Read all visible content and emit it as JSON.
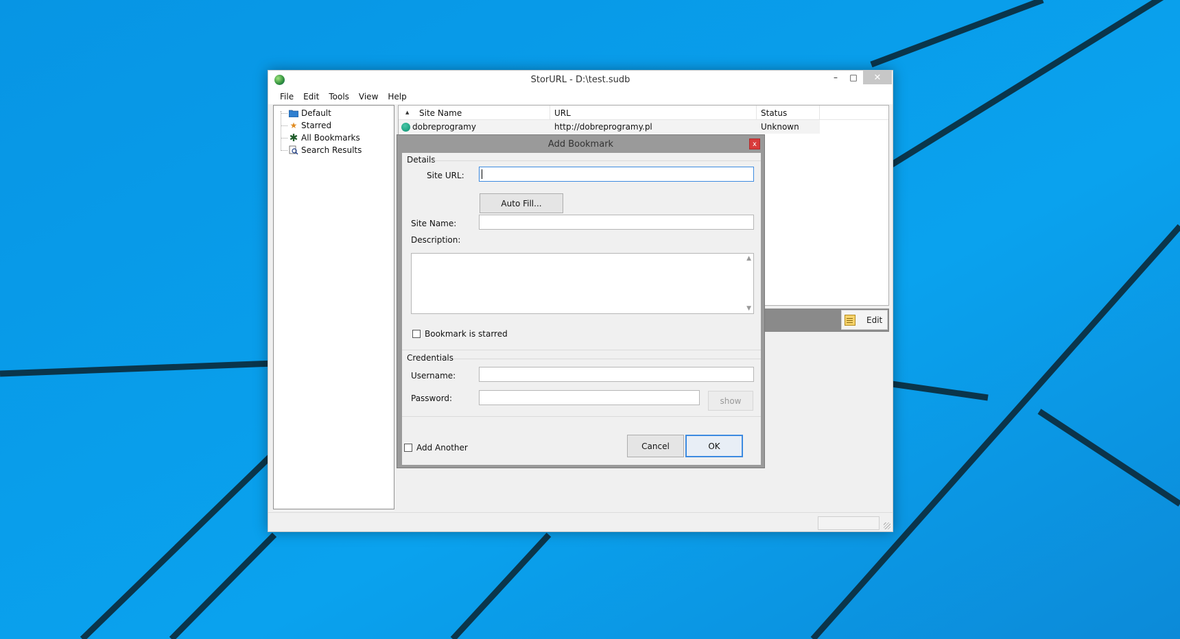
{
  "window": {
    "title": "StorURL - D:\\test.sudb",
    "controls": {
      "minimize": "–",
      "maximize": "□",
      "close": "✕"
    }
  },
  "menu": [
    "File",
    "Edit",
    "Tools",
    "View",
    "Help"
  ],
  "tree": [
    {
      "label": "Default",
      "icon": "folder-icon"
    },
    {
      "label": "Starred",
      "icon": "star-icon"
    },
    {
      "label": "All Bookmarks",
      "icon": "asterisk-icon"
    },
    {
      "label": "Search Results",
      "icon": "search-results-icon"
    }
  ],
  "list": {
    "sort_arrow": "▲",
    "columns": [
      "Site Name",
      "URL",
      "Status"
    ],
    "rows": [
      {
        "site_name": "dobreprogramy",
        "url": "http://dobreprogramy.pl",
        "status": "Unknown"
      }
    ]
  },
  "detail": {
    "edit_label": "Edit"
  },
  "dialog": {
    "title": "Add Bookmark",
    "close": "x",
    "details_group": "Details",
    "site_url_label": "Site URL:",
    "site_url_value": "",
    "autofill_label": "Auto Fill...",
    "site_name_label": "Site Name:",
    "site_name_value": "",
    "description_label": "Description:",
    "description_value": "",
    "starred_label": "Bookmark is starred",
    "starred_checked": false,
    "credentials_group": "Credentials",
    "username_label": "Username:",
    "username_value": "",
    "password_label": "Password:",
    "password_value": "",
    "show_label": "show",
    "add_another_label": "Add Another",
    "add_another_checked": false,
    "cancel_label": "Cancel",
    "ok_label": "OK",
    "scroll_up": "▲",
    "scroll_down": "▼"
  },
  "colors": {
    "desktop": "#0a8ee0",
    "accent": "#3c8ae0",
    "close_red": "#d83b3b"
  }
}
